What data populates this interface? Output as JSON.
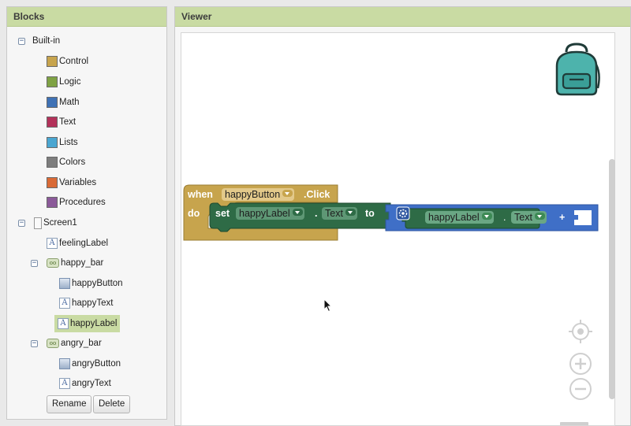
{
  "blocks_panel": {
    "title": "Blocks",
    "builtin": {
      "label": "Built-in",
      "toggle": "−",
      "items": [
        {
          "label": "Control",
          "color": "#c7a44d"
        },
        {
          "label": "Logic",
          "color": "#7fa244"
        },
        {
          "label": "Math",
          "color": "#3f72b5"
        },
        {
          "label": "Text",
          "color": "#b3325a"
        },
        {
          "label": "Lists",
          "color": "#4aa6d1"
        },
        {
          "label": "Colors",
          "color": "#7d7d7d"
        },
        {
          "label": "Variables",
          "color": "#d96a36"
        },
        {
          "label": "Procedures",
          "color": "#8b5a99"
        }
      ]
    },
    "screen": {
      "label": "Screen1",
      "toggle": "−",
      "components": [
        {
          "label": "feelingLabel",
          "icon": "label-icon",
          "glyph": "A"
        },
        {
          "label": "happy_bar",
          "icon": "arrangement-icon",
          "glyph": "oo",
          "toggle": "−"
        },
        {
          "label": "happyButton",
          "icon": "button-icon",
          "glyph": ""
        },
        {
          "label": "happyText",
          "icon": "label-icon",
          "glyph": "A"
        },
        {
          "label": "happyLabel",
          "icon": "label-icon",
          "glyph": "A"
        },
        {
          "label": "angry_bar",
          "icon": "arrangement-icon",
          "glyph": "oo",
          "toggle": "−"
        },
        {
          "label": "angryButton",
          "icon": "button-icon",
          "glyph": ""
        },
        {
          "label": "angryText",
          "icon": "label-icon",
          "glyph": "A"
        }
      ]
    },
    "rename_label": "Rename",
    "delete_label": "Delete"
  },
  "viewer": {
    "title": "Viewer",
    "event_block": {
      "when": "when",
      "component": "happyButton",
      "event": ".Click",
      "do": "do"
    },
    "set_block": {
      "set": "set",
      "component": "happyLabel",
      "dot": ".",
      "property": "Text",
      "to": "to"
    },
    "join_block": {
      "component": "happyLabel",
      "dot": ".",
      "property": "Text",
      "plus": "+"
    },
    "colors": {
      "control": "#c7a44d",
      "component_set": "#2e6b46",
      "component_get": "#3d8a55",
      "text": "#3f6fc7",
      "panel_header": "#c9dba3"
    },
    "icons": [
      "backpack-icon",
      "center-icon",
      "zoom-in-icon",
      "zoom-out-icon",
      "trash-icon"
    ]
  }
}
